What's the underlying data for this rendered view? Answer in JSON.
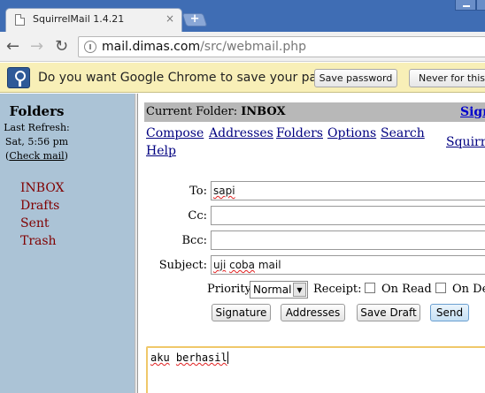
{
  "browser": {
    "tab_title": "SquirrelMail 1.4.21",
    "tab_close": "×",
    "new_tab": "+",
    "url_host": "mail.dimas.com",
    "url_path": "/src/webmail.php",
    "back": "←",
    "forward": "→",
    "reload": "↻"
  },
  "infobar": {
    "message": "Do you want Google Chrome to save your pa...",
    "save_label": "Save password",
    "never_label": "Never for this si"
  },
  "sidebar": {
    "title": "Folders",
    "last_refresh_label": "Last Refresh:",
    "last_refresh_time": "Sat, 5:56 pm",
    "check_mail_open": "(",
    "check_mail": "Check mail",
    "check_mail_close": ")",
    "folders": [
      "INBOX",
      "Drafts",
      "Sent",
      "Trash"
    ],
    "folder_color": "#800000"
  },
  "main": {
    "current_folder_label": "Current Folder:",
    "current_folder": "INBOX",
    "signout": "Sign",
    "nav": [
      "Compose",
      "Addresses",
      "Folders",
      "Options",
      "Search",
      "Help"
    ],
    "squirrel_link": "Squirre",
    "link_color": "#000080"
  },
  "compose": {
    "to_label": "To:",
    "to_value": "sapi",
    "cc_label": "Cc:",
    "cc_value": "",
    "bcc_label": "Bcc:",
    "bcc_value": "",
    "subject_label": "Subject:",
    "subject_word1": "uji",
    "subject_word2": "coba",
    "subject_word3": "mail",
    "priority_label": "Priority",
    "priority_value": "Normal",
    "receipt_label": "Receipt:",
    "on_read_label": "On Read",
    "on_delivery_label": "On De",
    "buttons": {
      "signature": "Signature",
      "addresses": "Addresses",
      "save_draft": "Save Draft",
      "send": "Send"
    },
    "body_word1": "aku",
    "body_word2": "berhasil"
  }
}
